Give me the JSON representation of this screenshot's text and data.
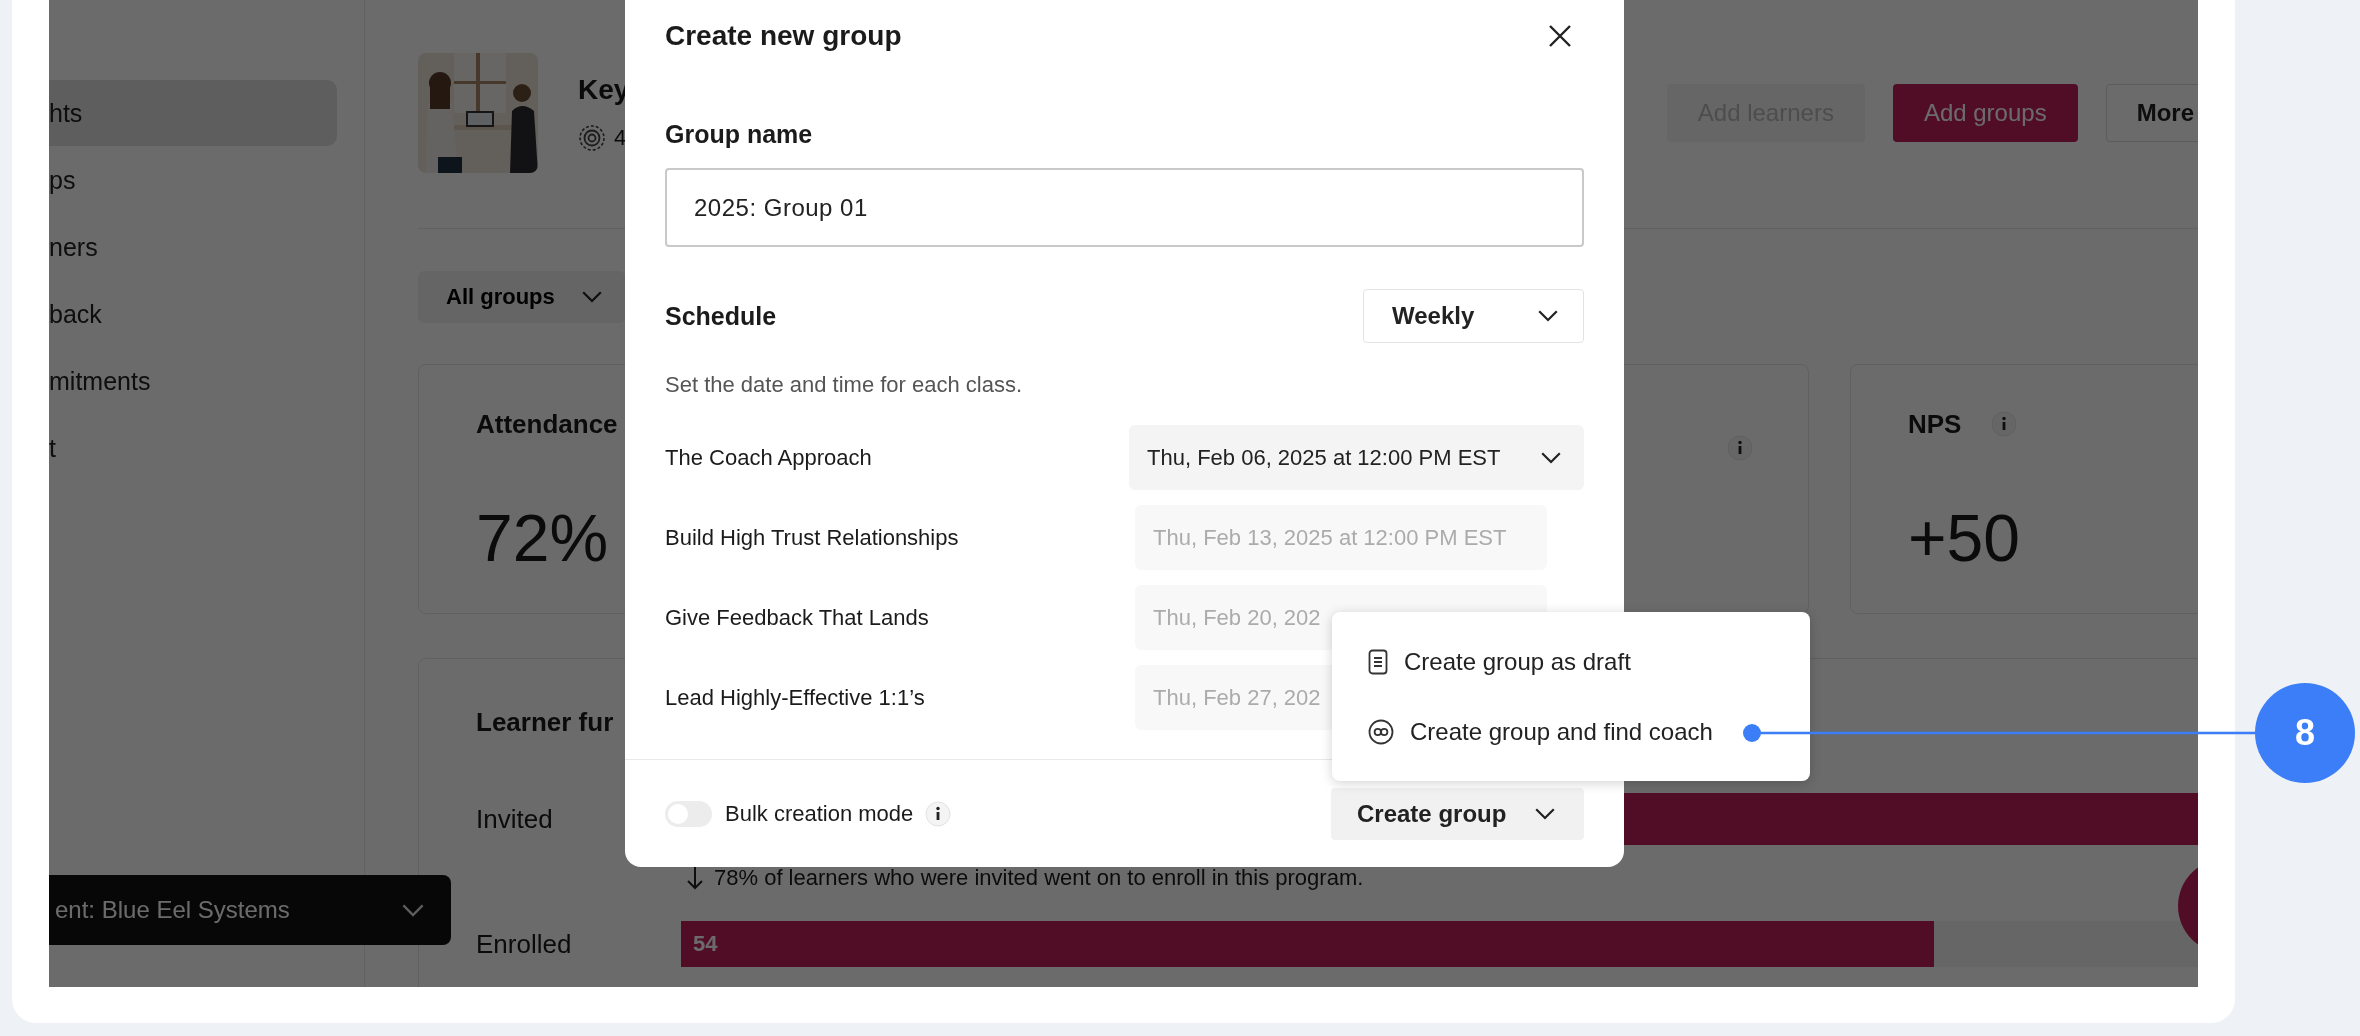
{
  "sidebar": {
    "items": [
      {
        "label": "hts",
        "selected": true
      },
      {
        "label": "ps",
        "selected": false
      },
      {
        "label": "ners",
        "selected": false
      },
      {
        "label": "back",
        "selected": false
      },
      {
        "label": "mitments",
        "selected": false
      },
      {
        "label": "t",
        "selected": false
      }
    ]
  },
  "client_selector": {
    "label": "ent: Blue Eel Systems"
  },
  "header": {
    "title": "Key",
    "meta": "4",
    "buttons": [
      {
        "label": "Add learners",
        "kind": "secondary",
        "disabled": true
      },
      {
        "label": "Add groups",
        "kind": "primary",
        "disabled": false
      },
      {
        "label": "More",
        "kind": "outline",
        "disabled": false
      }
    ]
  },
  "filter": {
    "label": "All groups"
  },
  "metrics": [
    {
      "title": "Attendance",
      "value": "72%"
    },
    {
      "info": true
    },
    {
      "title": "NPS",
      "value": "+50",
      "info": true
    }
  ],
  "funnel": {
    "title": "Learner fur",
    "stages": [
      {
        "label": "Invited",
        "level": 1
      },
      {
        "label": "Enrolled",
        "level": 0.79,
        "value": "54"
      }
    ],
    "note": "78% of learners who were invited went on to enroll in this program."
  },
  "modal": {
    "title": "Create new group",
    "group_name": {
      "label": "Group name",
      "value": "2025: Group 01"
    },
    "schedule": {
      "label": "Schedule",
      "frequency": "Weekly",
      "hint": "Set the date and time for each class.",
      "classes": [
        {
          "name": "The Coach Approach",
          "date": "Thu, Feb 06, 2025 at 12:00 PM EST",
          "disabled": false
        },
        {
          "name": "Build High Trust Relationships",
          "date": "Thu, Feb 13, 2025 at 12:00 PM EST",
          "disabled": true
        },
        {
          "name": "Give Feedback That Lands",
          "date": "Thu, Feb 20, 202",
          "disabled": true
        },
        {
          "name": "Lead Highly-Effective 1:1’s",
          "date": "Thu, Feb 27, 202",
          "disabled": true
        }
      ]
    },
    "bulk_mode": {
      "label": "Bulk creation mode",
      "on": false
    },
    "create_button": {
      "label": "Create group"
    }
  },
  "create_menu": {
    "items": [
      {
        "label": "Create group as draft",
        "kind": "draft"
      },
      {
        "label": "Create group and find coach",
        "kind": "coach"
      }
    ]
  },
  "annotation": {
    "label": "8"
  }
}
